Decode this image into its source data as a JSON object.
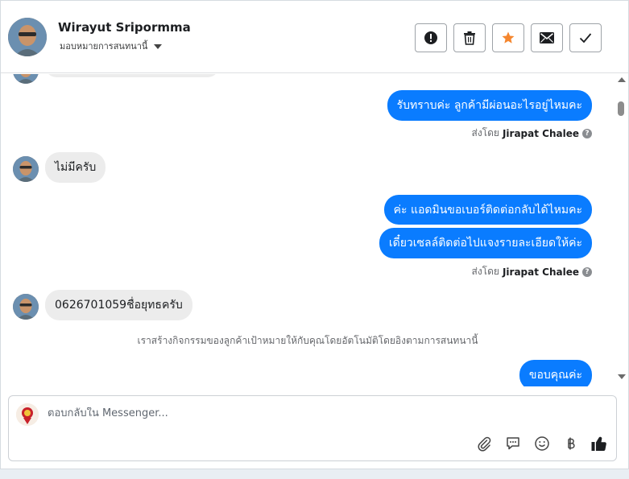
{
  "header": {
    "name": "Wirayut Sripormma",
    "assign_label": "มอบหมายการสนทนานี้"
  },
  "toolbar": {
    "buttons": [
      {
        "name": "report-button",
        "icon": "alert-circle-icon"
      },
      {
        "name": "delete-button",
        "icon": "trash-icon"
      },
      {
        "name": "star-button",
        "icon": "star-icon"
      },
      {
        "name": "mail-button",
        "icon": "envelope-icon"
      },
      {
        "name": "done-button",
        "icon": "check-icon"
      }
    ]
  },
  "messages": {
    "out_1": "รับทราบค่ะ ลูกค้ามีผ่อนอะไรอยู่ไหมคะ",
    "sent_by_prefix": "ส่งโดย",
    "sent_by_name": "Jirapat Chalee",
    "in_1": "ไม่มีครับ",
    "out_2": "ค่ะ แอดมินขอเบอร์ติดต่อกลับได้ไหมคะ",
    "out_3": "เดี๋ยวเซลล์ติดต่อไปแจงรายละเอียดให้ค่ะ",
    "in_2": "0626701059ชื่อยุทธครับ",
    "system": "เราสร้างกิจกรรมของลูกค้าเป้าหมายให้กับคุณโดยอัตโนมัติโดยอิงตามการสนทนานี้",
    "out_4": "ขอบคุณค่ะ"
  },
  "composer": {
    "placeholder": "ตอบกลับใน Messenger...",
    "value": ""
  },
  "colors": {
    "accent": "#0a7cff",
    "star": "#f5862e",
    "incoming_bg": "#ececec"
  }
}
